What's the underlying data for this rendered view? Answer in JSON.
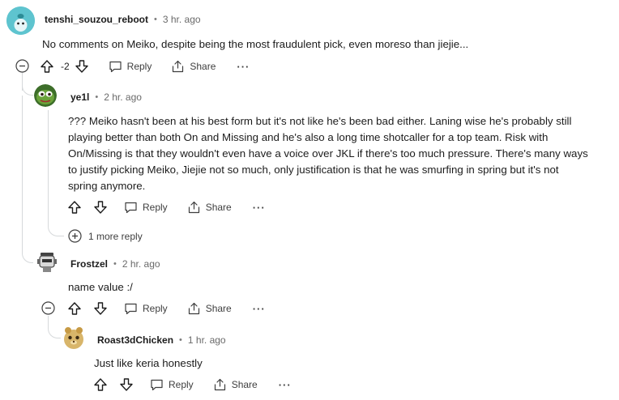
{
  "comments": [
    {
      "author": "tenshi_souzou_reboot",
      "time": "3 hr. ago",
      "body": "No comments on Meiko, despite being the most fraudulent pick, even moreso than jiejie...",
      "score": "-2",
      "reply_label": "Reply",
      "share_label": "Share",
      "more_label": "···"
    },
    {
      "author": "ye1l",
      "time": "2 hr. ago",
      "body_lines": [
        "??? Meiko hasn't been at his best form but it's not like he's been bad either. Laning wise he's probably still",
        "playing better than both On and Missing and he's also a long time shotcaller for a top team. Risk with",
        "On/Missing is that they wouldn't even have a voice over JKL if there's too much pressure. There's many ways",
        "to justify picking Meiko, Jiejie not so much, only justification is that he was smurfing in spring but it's not",
        "spring anymore."
      ],
      "reply_label": "Reply",
      "share_label": "Share",
      "more_label": "···",
      "more_replies": "1 more reply"
    },
    {
      "author": "Frostzel",
      "time": "2 hr. ago",
      "body": "name value :/",
      "reply_label": "Reply",
      "share_label": "Share",
      "more_label": "···"
    },
    {
      "author": "Roast3dChicken",
      "time": "1 hr. ago",
      "body": "Just like keria honestly",
      "reply_label": "Reply",
      "share_label": "Share",
      "more_label": "···"
    }
  ],
  "separator": "•"
}
